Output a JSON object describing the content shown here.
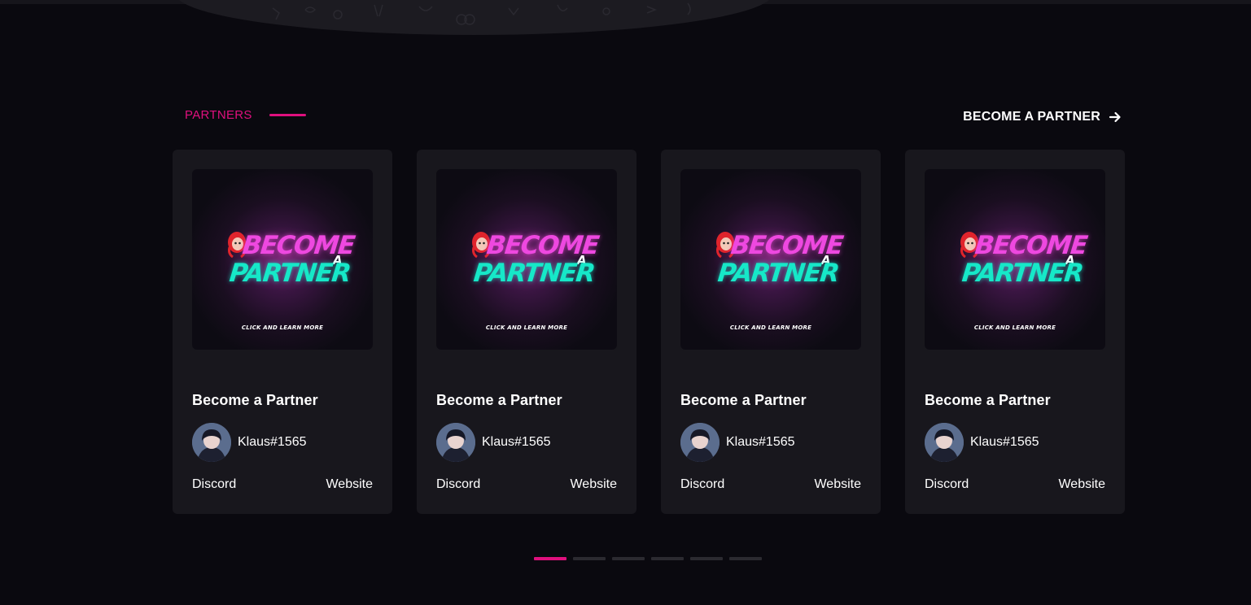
{
  "section": {
    "label": "PARTNERS",
    "cta_label": "BECOME A PARTNER",
    "accent": "#e0107e"
  },
  "cards": [
    {
      "image": {
        "line1": "BECOME",
        "small": "A",
        "line2": "PARTNER",
        "caption": "CLICK AND LEARN MORE"
      },
      "title": "Become a Partner",
      "author": "Klaus#1565",
      "link_left": "Discord",
      "link_right": "Website"
    },
    {
      "image": {
        "line1": "BECOME",
        "small": "A",
        "line2": "PARTNER",
        "caption": "CLICK AND LEARN MORE"
      },
      "title": "Become a Partner",
      "author": "Klaus#1565",
      "link_left": "Discord",
      "link_right": "Website"
    },
    {
      "image": {
        "line1": "BECOME",
        "small": "A",
        "line2": "PARTNER",
        "caption": "CLICK AND LEARN MORE"
      },
      "title": "Become a Partner",
      "author": "Klaus#1565",
      "link_left": "Discord",
      "link_right": "Website"
    },
    {
      "image": {
        "line1": "BECOME",
        "small": "A",
        "line2": "PARTNER",
        "caption": "CLICK AND LEARN MORE"
      },
      "title": "Become a Partner",
      "author": "Klaus#1565",
      "link_left": "Discord",
      "link_right": "Website"
    }
  ],
  "pager": {
    "total": 6,
    "active_index": 0
  },
  "icons": {
    "cta": "arrow-right-icon"
  }
}
